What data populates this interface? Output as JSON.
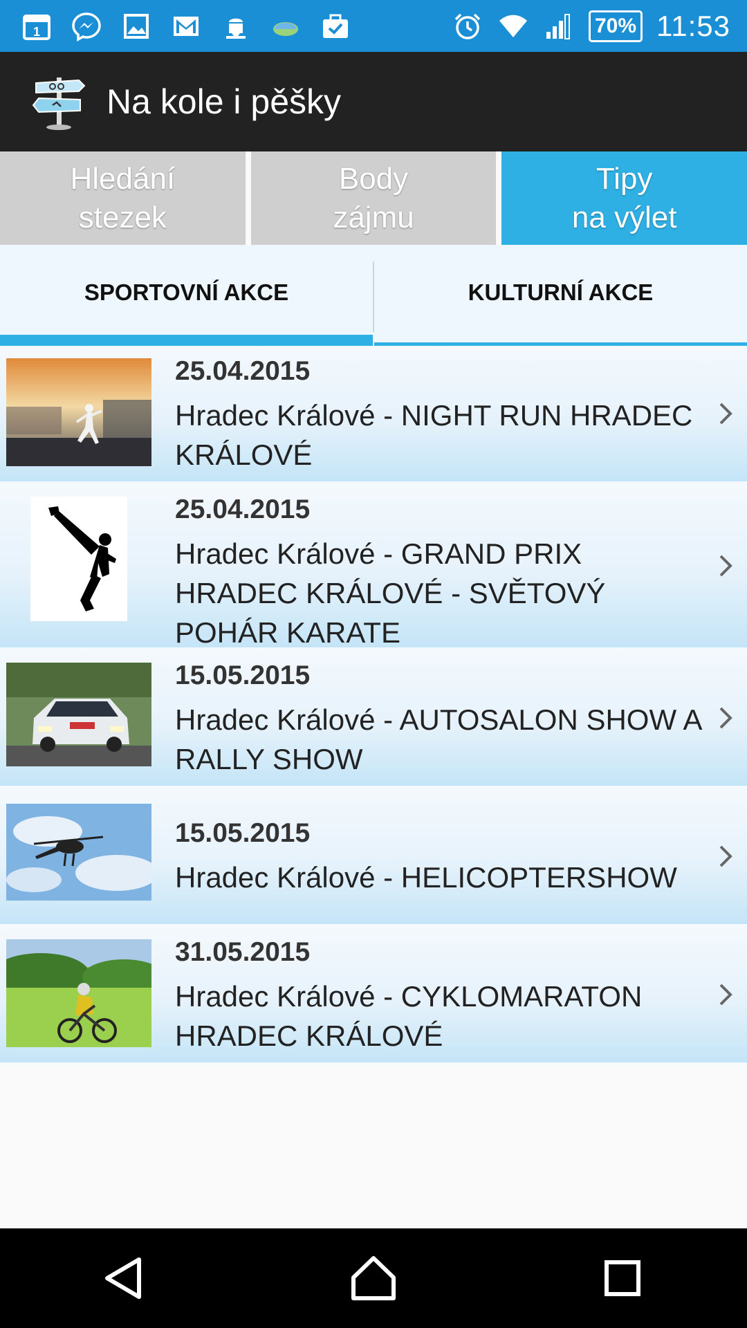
{
  "status_bar": {
    "battery": "70%",
    "time": "11:53",
    "left_icons": [
      "calendar-icon",
      "messenger-icon",
      "gallery-icon",
      "gmail-icon",
      "android-download-icon",
      "weather-icon",
      "briefcase-icon"
    ],
    "right_icons": [
      "alarm-icon",
      "wifi-icon",
      "signal-icon"
    ]
  },
  "app": {
    "title": "Na kole i pěšky"
  },
  "main_tabs": [
    {
      "label": "Hledání\nstezek",
      "active": false
    },
    {
      "label": "Body\nzájmu",
      "active": false
    },
    {
      "label": "Tipy\nna výlet",
      "active": true
    }
  ],
  "sub_tabs": [
    {
      "label": "SPORTOVNÍ AKCE",
      "active": true
    },
    {
      "label": "KULTURNÍ AKCE",
      "active": false
    }
  ],
  "events": [
    {
      "date": "25.04.2015",
      "title": "Hradec Králové - NIGHT RUN HRADEC KRÁLOVÉ",
      "thumb": "night-run-photo"
    },
    {
      "date": "25.04.2015",
      "title": "Hradec Králové - GRAND PRIX HRADEC KRÁLOVÉ - SVĚTOVÝ POHÁR KARATE",
      "thumb": "karate-silhouette"
    },
    {
      "date": "15.05.2015",
      "title": "Hradec Králové - AUTOSALON SHOW A RALLY SHOW",
      "thumb": "rally-car-photo"
    },
    {
      "date": "15.05.2015",
      "title": "Hradec Králové - HELICOPTERSHOW",
      "thumb": "helicopter-photo"
    },
    {
      "date": "31.05.2015",
      "title": "Hradec Králové - CYKLOMARATON HRADEC KRÁLOVÉ",
      "thumb": "cyclist-photo"
    }
  ],
  "colors": {
    "status_bar": "#1b8fd6",
    "action_bar": "#222222",
    "tab_active": "#2fb0e4",
    "tab_inactive": "#cfcfcf"
  }
}
